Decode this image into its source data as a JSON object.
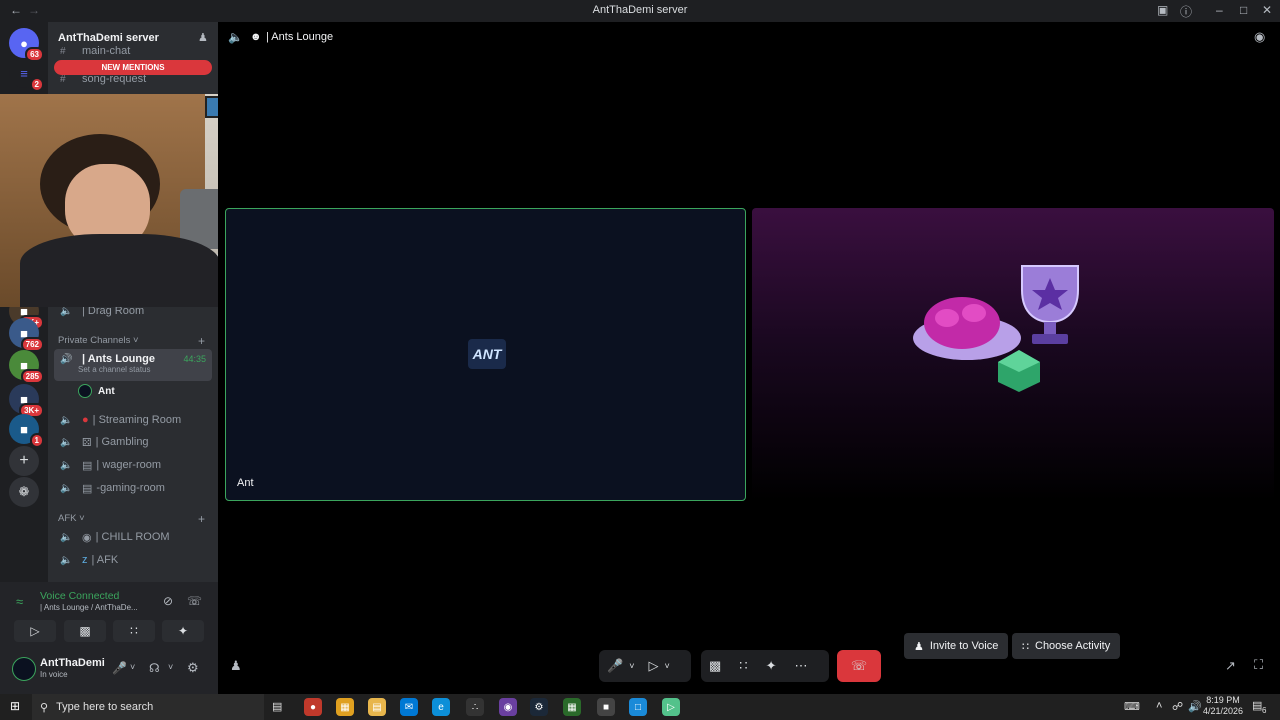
{
  "window": {
    "title": "AntThaDemi server"
  },
  "guilds": {
    "items": [
      {
        "badge": "63",
        "icon": "discord-home-icon"
      },
      {
        "badge": "2",
        "icon": "sound-wave-icon"
      },
      {
        "badge": "2K+",
        "icon": "server-icon"
      },
      {
        "badge": "762",
        "icon": "server-icon"
      },
      {
        "badge": "285",
        "icon": "server-icon"
      },
      {
        "badge": "3K+",
        "icon": "server-icon"
      },
      {
        "badge": "1",
        "icon": "server-icon"
      }
    ],
    "add_icon": "plus-icon",
    "discover_icon": "compass-icon"
  },
  "server": {
    "name": "AntThaDemi server",
    "new_mentions": "NEW MENTIONS"
  },
  "channels": {
    "top": [
      {
        "name": "main-chat"
      },
      {
        "name": "song-request"
      }
    ],
    "drag_room": "| Drag Room",
    "category_private": "Private Channels",
    "ants_lounge": {
      "name": "| Ants Lounge",
      "timer": "44:35",
      "status": "Set a channel status",
      "member": "Ant"
    },
    "list": [
      {
        "name": "| Streaming Room"
      },
      {
        "name": "| Gambling"
      },
      {
        "name": "| wager-room"
      },
      {
        "name": "-gaming-room"
      }
    ],
    "category_afk": "AFK",
    "afk": [
      {
        "name": "| CHILL ROOM"
      },
      {
        "name": "| AFK"
      }
    ]
  },
  "voice": {
    "status": "Voice Connected",
    "location": "| Ants Lounge / AntThaDe..."
  },
  "user": {
    "name": "AntThaDemi",
    "status": "In voice"
  },
  "header": {
    "channel": "| Ants Lounge"
  },
  "tiles": {
    "ant_label": "Ant",
    "ant_logo": "ANT",
    "invite": "Invite to Voice",
    "choose": "Choose Activity"
  },
  "taskbar": {
    "search": "Type here to search",
    "time": "8:19 PM",
    "date": "4/21/2026",
    "notif": "6"
  },
  "colors": {
    "accent_green": "#3ba55d",
    "danger": "#da373c",
    "bg_dark": "#1e1f22"
  }
}
